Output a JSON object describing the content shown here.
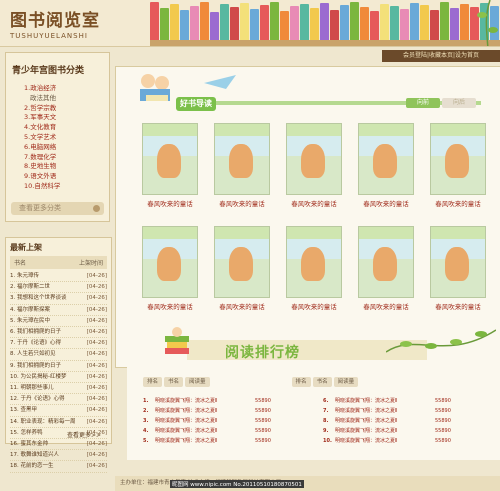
{
  "header": {
    "logo_cn": "图书阅览室",
    "logo_en": "TUSHUYUELANSHI",
    "book_colors": [
      "#e65a5a",
      "#7bb63f",
      "#f2c94c",
      "#6aa9d8",
      "#e88bb5",
      "#f08a3a",
      "#9b6bd0",
      "#58b8a0",
      "#d04a4a",
      "#f3e07a",
      "#6aa9d8",
      "#e65a5a",
      "#7bb63f",
      "#f08a3a",
      "#e88bb5",
      "#58b8a0",
      "#f2c94c",
      "#9b6bd0",
      "#d04a4a",
      "#6aa9d8",
      "#7bb63f",
      "#f08a3a",
      "#e65a5a",
      "#f3e07a",
      "#58b8a0",
      "#e88bb5",
      "#6aa9d8",
      "#f2c94c",
      "#d04a4a",
      "#7bb63f",
      "#9b6bd0",
      "#f08a3a",
      "#e65a5a",
      "#58b8a0",
      "#6aa9d8"
    ]
  },
  "user_bar": "会员登陆|收藏本页|设为首页",
  "categories": {
    "title": "青少年宫图书分类",
    "items": [
      {
        "label": "1.政治经济",
        "sub": false
      },
      {
        "label": "政法其他",
        "sub": true
      },
      {
        "label": "2.哲学宗教",
        "sub": false
      },
      {
        "label": "3.军事天文",
        "sub": false
      },
      {
        "label": "4.文化教育",
        "sub": false
      },
      {
        "label": "5.文学艺术",
        "sub": false
      },
      {
        "label": "6.电脑网络",
        "sub": false
      },
      {
        "label": "7.数理化学",
        "sub": false
      },
      {
        "label": "8.史地生物",
        "sub": false
      },
      {
        "label": "9.语文外语",
        "sub": false
      },
      {
        "label": "10.自然科学",
        "sub": false
      }
    ],
    "more": "查看更多分类"
  },
  "new_books": {
    "title": "最新上架",
    "col1": "书名",
    "col2": "上架时间",
    "items": [
      {
        "name": "1. 朱元璋传",
        "date": "[04-26]"
      },
      {
        "name": "2. 福尔摩斯二世",
        "date": "[04-26]"
      },
      {
        "name": "3. 我想和这个世界谈谈",
        "date": "[04-26]"
      },
      {
        "name": "4. 福尔摩斯探案",
        "date": "[04-26]"
      },
      {
        "name": "5. 朱元璋在民中",
        "date": "[04-26]"
      },
      {
        "name": "6. 我们相拥爬的日子",
        "date": "[04-26]"
      },
      {
        "name": "7. 于丹《论语》心得",
        "date": "[04-26]"
      },
      {
        "name": "8. 人生若只如初见",
        "date": "[04-26]"
      },
      {
        "name": "9. 我们相拥爬的日子",
        "date": "[04-26]"
      },
      {
        "name": "10. 为公民揭秘-红楼梦",
        "date": "[04-26]"
      },
      {
        "name": "11. 明朝那些事儿",
        "date": "[04-26]"
      },
      {
        "name": "12. 于丹《论语》心得",
        "date": "[04-26]"
      },
      {
        "name": "13. 查黑甲",
        "date": "[04-26]"
      },
      {
        "name": "14. 职业表现：精彩每一周",
        "date": "[04-26]"
      },
      {
        "name": "15. 怎样养鸭",
        "date": "[04-26]"
      },
      {
        "name": "16. 蜜其东金帅",
        "date": "[04-26]"
      },
      {
        "name": "17. 歌舞谁知道兴人",
        "date": "[04-26]"
      },
      {
        "name": "18. 花前的恋一生",
        "date": "[04-26]"
      }
    ],
    "more": "查看更多>>"
  },
  "recommend": {
    "tag": "好书导读",
    "nav_prev": "向前",
    "nav_next": "向后",
    "books": [
      "春风吹来的童话",
      "春风吹来的童话",
      "春风吹来的童话",
      "春风吹来的童话",
      "春风吹来的童话",
      "春风吹来的童话",
      "春风吹来的童话",
      "春风吹来的童话",
      "春风吹来的童话",
      "春风吹来的童话"
    ]
  },
  "ranking": {
    "title": "阅读排行榜",
    "headers": [
      "排名",
      "书名",
      "阅读量",
      "排名",
      "书名",
      "阅读量"
    ],
    "left": [
      {
        "n": "1.",
        "b": "明晓溪旋翼飞翔：流冰之夏Ⅱ",
        "c": "55890"
      },
      {
        "n": "2.",
        "b": "明晓溪旋翼飞翔：流冰之夏Ⅱ",
        "c": "55890"
      },
      {
        "n": "3.",
        "b": "明晓溪旋翼飞翔：流冰之夏Ⅱ",
        "c": "55890"
      },
      {
        "n": "4.",
        "b": "明晓溪旋翼飞翔：流冰之夏Ⅱ",
        "c": "55890"
      },
      {
        "n": "5.",
        "b": "明晓溪旋翼飞翔：流冰之夏Ⅱ",
        "c": "55890"
      }
    ],
    "right": [
      {
        "n": "6.",
        "b": "明晓溪旋翼飞翔：流冰之夏Ⅱ",
        "c": "55890"
      },
      {
        "n": "7.",
        "b": "明晓溪旋翼飞翔：流冰之夏Ⅱ",
        "c": "55890"
      },
      {
        "n": "8.",
        "b": "明晓溪旋翼飞翔：流冰之夏Ⅱ",
        "c": "55890"
      },
      {
        "n": "9.",
        "b": "明晓溪旋翼飞翔：流冰之夏Ⅱ",
        "c": "55890"
      },
      {
        "n": "10.",
        "b": "明晓溪旋翼飞翔：流冰之夏Ⅱ",
        "c": "55890"
      }
    ]
  },
  "footer": "主办单位：福建市青少年宫  技术支持：福建锐智数码科技有限公司",
  "watermark": "昵图网 www.nipic.com  No.20110510180870501"
}
